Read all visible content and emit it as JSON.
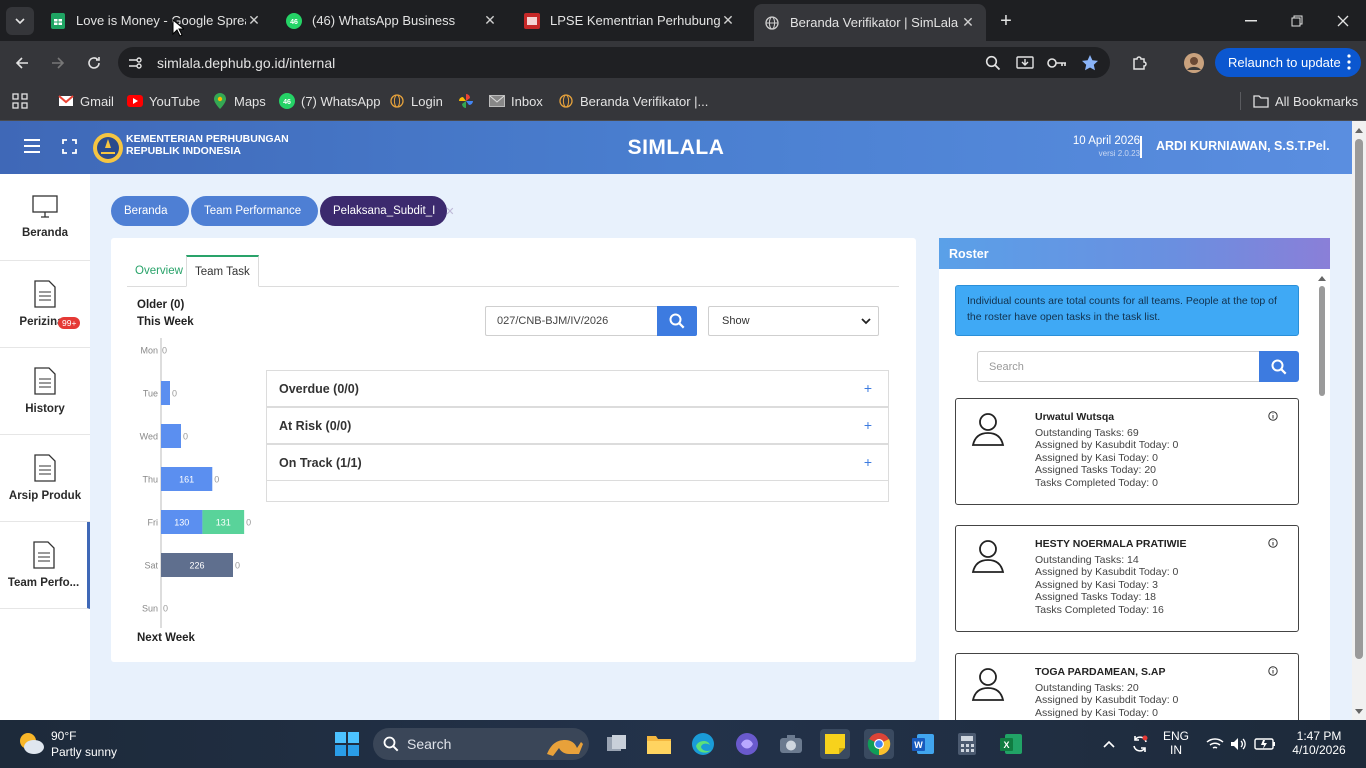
{
  "browser": {
    "tabs": [
      {
        "title": "Love is Money - Google Spread",
        "favicon": "sheets-icon"
      },
      {
        "title": "(46) WhatsApp Business",
        "favicon": "whatsapp-icon"
      },
      {
        "title": "LPSE Kementrian Perhubungan",
        "favicon": "lpse-icon"
      },
      {
        "title": "Beranda Verifikator | SimLala",
        "favicon": "globe-icon"
      }
    ],
    "active_tab": 3,
    "url": "simlala.dephub.go.id/internal",
    "relaunch_label": "Relaunch to update",
    "bookmarks": [
      "Gmail",
      "YouTube",
      "Maps",
      "(7) WhatsApp",
      "Login",
      "",
      "Inbox",
      "Beranda Verifikator |..."
    ],
    "all_bookmarks": "All Bookmarks",
    "whatsapp_count": "46"
  },
  "app": {
    "org_line1": "KEMENTERIAN PERHUBUNGAN",
    "org_line2": "REPUBLIK INDONESIA",
    "title": "SIMLALA",
    "date": "10 April 2026",
    "version": "versi 2.0.23",
    "user": "ARDI KURNIAWAN, S.S.T.Pel."
  },
  "sidebar": {
    "items": [
      {
        "label": "Beranda"
      },
      {
        "label": "Perizinan",
        "badge": "99+"
      },
      {
        "label": "History"
      },
      {
        "label": "Arsip Produk"
      },
      {
        "label": "Team Perfo..."
      }
    ]
  },
  "breadcrumbs": [
    "Beranda",
    "Team Performance",
    "Pelaksana_Subdit_I"
  ],
  "panel": {
    "tabs": [
      "Overview",
      "Team Task"
    ],
    "older": "Older (0)",
    "this_week": "This Week",
    "next_week": "Next Week",
    "search_value": "027/CNB-BJM/IV/2026",
    "show_select": "Show",
    "accordion": [
      {
        "label": "Overdue (0/0)"
      },
      {
        "label": "At Risk (0/0)"
      },
      {
        "label": "On Track (1/1)"
      }
    ]
  },
  "chart_data": {
    "type": "bar",
    "orientation": "horizontal",
    "categories": [
      "Mon",
      "Tue",
      "Wed",
      "Thu",
      "Fri",
      "Sat",
      "Sun"
    ],
    "series": [
      {
        "values": [
          0,
          0,
          0,
          161,
          130,
          226,
          0
        ],
        "colors": [
          "#5b8ff0",
          "#5b8ff0",
          "#5b8ff0",
          "#5b8ff0",
          "#5b8ff0",
          "#5f6f8e",
          "#5b8ff0"
        ]
      },
      {
        "values": [
          0,
          0,
          0,
          0,
          131,
          0,
          0
        ],
        "color": "#59d39a"
      }
    ],
    "bar_labels": [
      [
        "0",
        "",
        ""
      ],
      [
        "",
        "0",
        ""
      ],
      [
        "",
        "0",
        ""
      ],
      [
        "161",
        "0",
        ""
      ],
      [
        "130",
        "131",
        "0"
      ],
      [
        "226",
        "0",
        ""
      ],
      [
        "",
        "0",
        ""
      ]
    ]
  },
  "roster": {
    "title": "Roster",
    "info": "Individual counts are total counts for all teams. People at the top of the roster have open tasks in the task list.",
    "search_placeholder": "Search",
    "people": [
      {
        "name": "Urwatul Wutsqa",
        "lines": [
          "Outstanding Tasks: 69",
          "Assigned by Kasubdit Today: 0",
          "Assigned by Kasi Today: 0",
          "Assigned Tasks Today: 20",
          "Tasks Completed Today: 0"
        ]
      },
      {
        "name": "HESTY NOERMALA PRATIWIE",
        "lines": [
          "Outstanding Tasks: 14",
          "Assigned by Kasubdit Today: 0",
          "Assigned by Kasi Today: 3",
          "Assigned Tasks Today: 18",
          "Tasks Completed Today: 16"
        ]
      },
      {
        "name": "TOGA PARDAMEAN, S.AP",
        "lines": [
          "Outstanding Tasks: 20",
          "Assigned by Kasubdit Today: 0",
          "Assigned by Kasi Today: 0"
        ]
      }
    ]
  },
  "taskbar": {
    "temp": "90°F",
    "weather": "Partly sunny",
    "search": "Search",
    "lang1": "ENG",
    "lang2": "IN",
    "time": "1:47 PM",
    "date": "4/10/2026"
  }
}
